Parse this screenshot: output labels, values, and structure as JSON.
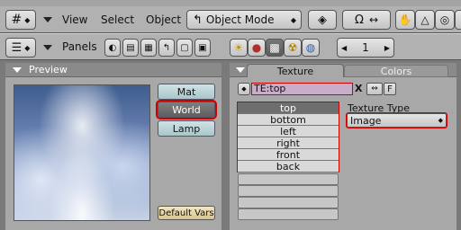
{
  "header1": {
    "view": "View",
    "select": "Select",
    "object": "Object",
    "mode": "Object Mode"
  },
  "header2": {
    "panels": "Panels",
    "frame": "1"
  },
  "preview": {
    "title": "Preview",
    "buttons": [
      "Mat",
      "World",
      "Lamp"
    ],
    "selected": "World",
    "default_vars": "Default Vars"
  },
  "texture": {
    "tabs": [
      "Texture",
      "Colors"
    ],
    "name": "TE:top",
    "x_label": "X",
    "f_label": "F",
    "channels": [
      "top",
      "bottom",
      "left",
      "right",
      "front",
      "back"
    ],
    "selected_channel": "top",
    "type_label": "Texture Type",
    "type_value": "Image"
  },
  "colors": {
    "selected_red": "#d10000",
    "panel_bg": "#a8a8a8"
  }
}
